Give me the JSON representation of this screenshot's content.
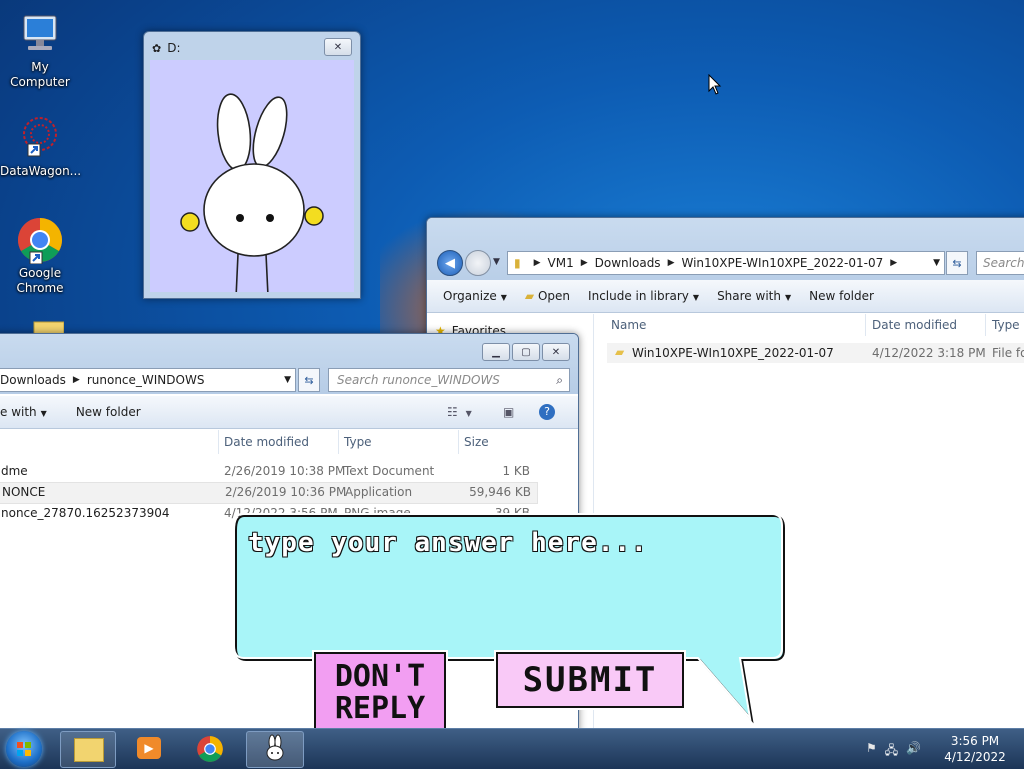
{
  "desktop_icons": [
    {
      "label": "My Computer",
      "icon": "computer-icon"
    },
    {
      "label": "DataWagon...",
      "icon": "datawagon-icon"
    },
    {
      "label": "Google Chrome",
      "icon": "chrome-icon"
    }
  ],
  "drive_window": {
    "title": "D:"
  },
  "explorer_right": {
    "breadcrumb": [
      "VM1",
      "Downloads",
      "Win10XPE-WIn10XPE_2022-01-07"
    ],
    "search_placeholder": "Search W",
    "toolbar": {
      "organize": "Organize",
      "open": "Open",
      "include": "Include in library",
      "share": "Share with",
      "new_folder": "New folder"
    },
    "nav_favorites": "Favorites",
    "columns": {
      "name": "Name",
      "date": "Date modified",
      "type": "Type"
    },
    "rows": [
      {
        "name": "Win10XPE-WIn10XPE_2022-01-07",
        "date": "4/12/2022 3:18 PM",
        "type": "File fo"
      }
    ]
  },
  "explorer_left": {
    "breadcrumb": [
      "Downloads",
      "runonce_WINDOWS"
    ],
    "search_placeholder": "Search runonce_WINDOWS",
    "toolbar": {
      "share": "e with",
      "new_folder": "New folder"
    },
    "columns": {
      "date": "Date modified",
      "type": "Type",
      "size": "Size"
    },
    "rows": [
      {
        "name": "dme",
        "date": "2/26/2019 10:38 PM",
        "type": "Text Document",
        "size": "1 KB"
      },
      {
        "name": "NONCE",
        "date": "2/26/2019 10:36 PM",
        "type": "Application",
        "size": "59,946 KB"
      },
      {
        "name": "nonce_27870.16252373904",
        "date": "4/12/2022 3:56 PM",
        "type": "PNG image",
        "size": "39 KB"
      }
    ]
  },
  "prompt_dialog": {
    "input_placeholder": "type your answer here...",
    "dont_reply": "DON'T REPLY",
    "submit": "SUBMIT"
  },
  "taskbar": {
    "time": "3:56 PM",
    "date": "4/12/2022",
    "apps": [
      "start-orb-icon",
      "explorer-icon",
      "media-player-icon",
      "chrome-icon",
      "bunny-app-icon"
    ]
  },
  "colors": {
    "desktop": "#0d5cb3",
    "bubble": "#a8f5f8",
    "dont_reply_button": "#f29ef2",
    "submit_button": "#f9c9f7",
    "bunny_bg": "#ccccff"
  }
}
